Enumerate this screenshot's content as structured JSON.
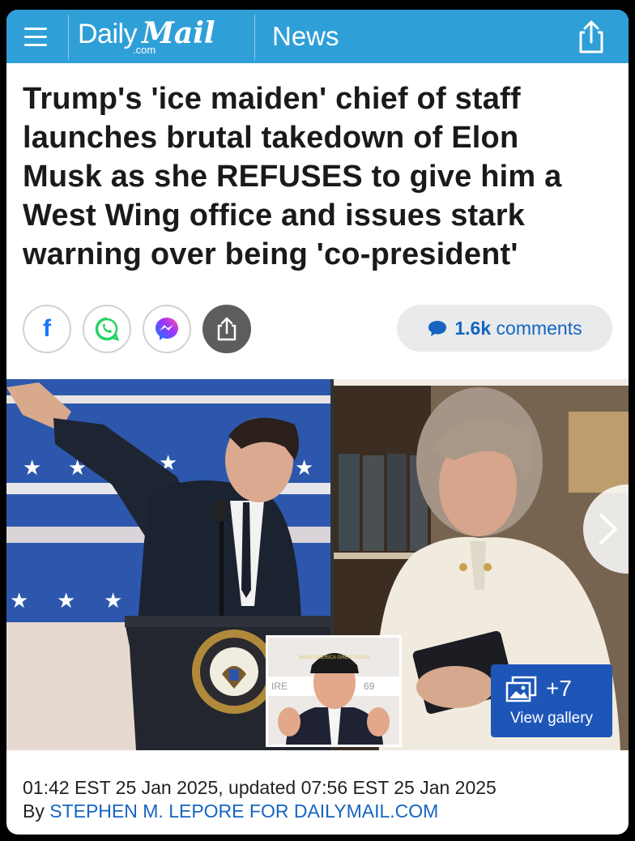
{
  "header": {
    "brand_daily": "Daily",
    "brand_mail": "Mail",
    "brand_com": ".com",
    "section": "News",
    "menu_icon": "hamburger-menu-icon",
    "share_icon": "share-icon",
    "color": "#2f9fd8"
  },
  "article": {
    "headline": "Trump's 'ice maiden' chief of staff launches brutal takedown of Elon Musk as she REFUSES to give him a West Wing office and issues stark warning over being 'co-president'",
    "timestamp": "01:42 EST 25 Jan 2025, updated 07:56 EST 25 Jan 2025",
    "byline_prefix": "By ",
    "author": "STEPHEN M. LEPORE FOR DAILYMAIL.COM"
  },
  "social": {
    "facebook_label": "f",
    "buttons": [
      "facebook-icon",
      "whatsapp-icon",
      "messenger-icon",
      "share-icon"
    ],
    "comments_count": "1.6k",
    "comments_label": "comments"
  },
  "gallery": {
    "count": "+7",
    "label": "View gallery",
    "inset_cap_text": "MAKE AMERICA GREAT AGAIN",
    "podium_seal_text": "PRESIDENT OF THE UNITED STATES"
  },
  "colors": {
    "link_blue": "#1565c0",
    "gallery_blue": "#1e56b8",
    "comments_bg": "#e9eaec"
  }
}
